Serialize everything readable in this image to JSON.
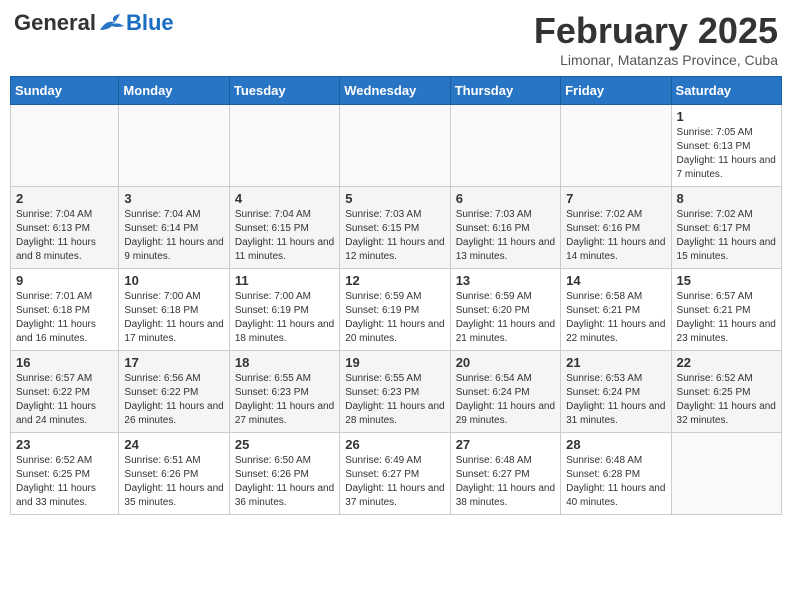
{
  "header": {
    "logo": {
      "general": "General",
      "blue": "Blue"
    },
    "month": "February 2025",
    "location": "Limonar, Matanzas Province, Cuba"
  },
  "days_of_week": [
    "Sunday",
    "Monday",
    "Tuesday",
    "Wednesday",
    "Thursday",
    "Friday",
    "Saturday"
  ],
  "weeks": [
    {
      "days": [
        {
          "num": "",
          "info": ""
        },
        {
          "num": "",
          "info": ""
        },
        {
          "num": "",
          "info": ""
        },
        {
          "num": "",
          "info": ""
        },
        {
          "num": "",
          "info": ""
        },
        {
          "num": "",
          "info": ""
        },
        {
          "num": "1",
          "info": "Sunrise: 7:05 AM\nSunset: 6:13 PM\nDaylight: 11 hours and 7 minutes."
        }
      ]
    },
    {
      "days": [
        {
          "num": "2",
          "info": "Sunrise: 7:04 AM\nSunset: 6:13 PM\nDaylight: 11 hours and 8 minutes."
        },
        {
          "num": "3",
          "info": "Sunrise: 7:04 AM\nSunset: 6:14 PM\nDaylight: 11 hours and 9 minutes."
        },
        {
          "num": "4",
          "info": "Sunrise: 7:04 AM\nSunset: 6:15 PM\nDaylight: 11 hours and 11 minutes."
        },
        {
          "num": "5",
          "info": "Sunrise: 7:03 AM\nSunset: 6:15 PM\nDaylight: 11 hours and 12 minutes."
        },
        {
          "num": "6",
          "info": "Sunrise: 7:03 AM\nSunset: 6:16 PM\nDaylight: 11 hours and 13 minutes."
        },
        {
          "num": "7",
          "info": "Sunrise: 7:02 AM\nSunset: 6:16 PM\nDaylight: 11 hours and 14 minutes."
        },
        {
          "num": "8",
          "info": "Sunrise: 7:02 AM\nSunset: 6:17 PM\nDaylight: 11 hours and 15 minutes."
        }
      ]
    },
    {
      "days": [
        {
          "num": "9",
          "info": "Sunrise: 7:01 AM\nSunset: 6:18 PM\nDaylight: 11 hours and 16 minutes."
        },
        {
          "num": "10",
          "info": "Sunrise: 7:00 AM\nSunset: 6:18 PM\nDaylight: 11 hours and 17 minutes."
        },
        {
          "num": "11",
          "info": "Sunrise: 7:00 AM\nSunset: 6:19 PM\nDaylight: 11 hours and 18 minutes."
        },
        {
          "num": "12",
          "info": "Sunrise: 6:59 AM\nSunset: 6:19 PM\nDaylight: 11 hours and 20 minutes."
        },
        {
          "num": "13",
          "info": "Sunrise: 6:59 AM\nSunset: 6:20 PM\nDaylight: 11 hours and 21 minutes."
        },
        {
          "num": "14",
          "info": "Sunrise: 6:58 AM\nSunset: 6:21 PM\nDaylight: 11 hours and 22 minutes."
        },
        {
          "num": "15",
          "info": "Sunrise: 6:57 AM\nSunset: 6:21 PM\nDaylight: 11 hours and 23 minutes."
        }
      ]
    },
    {
      "days": [
        {
          "num": "16",
          "info": "Sunrise: 6:57 AM\nSunset: 6:22 PM\nDaylight: 11 hours and 24 minutes."
        },
        {
          "num": "17",
          "info": "Sunrise: 6:56 AM\nSunset: 6:22 PM\nDaylight: 11 hours and 26 minutes."
        },
        {
          "num": "18",
          "info": "Sunrise: 6:55 AM\nSunset: 6:23 PM\nDaylight: 11 hours and 27 minutes."
        },
        {
          "num": "19",
          "info": "Sunrise: 6:55 AM\nSunset: 6:23 PM\nDaylight: 11 hours and 28 minutes."
        },
        {
          "num": "20",
          "info": "Sunrise: 6:54 AM\nSunset: 6:24 PM\nDaylight: 11 hours and 29 minutes."
        },
        {
          "num": "21",
          "info": "Sunrise: 6:53 AM\nSunset: 6:24 PM\nDaylight: 11 hours and 31 minutes."
        },
        {
          "num": "22",
          "info": "Sunrise: 6:52 AM\nSunset: 6:25 PM\nDaylight: 11 hours and 32 minutes."
        }
      ]
    },
    {
      "days": [
        {
          "num": "23",
          "info": "Sunrise: 6:52 AM\nSunset: 6:25 PM\nDaylight: 11 hours and 33 minutes."
        },
        {
          "num": "24",
          "info": "Sunrise: 6:51 AM\nSunset: 6:26 PM\nDaylight: 11 hours and 35 minutes."
        },
        {
          "num": "25",
          "info": "Sunrise: 6:50 AM\nSunset: 6:26 PM\nDaylight: 11 hours and 36 minutes."
        },
        {
          "num": "26",
          "info": "Sunrise: 6:49 AM\nSunset: 6:27 PM\nDaylight: 11 hours and 37 minutes."
        },
        {
          "num": "27",
          "info": "Sunrise: 6:48 AM\nSunset: 6:27 PM\nDaylight: 11 hours and 38 minutes."
        },
        {
          "num": "28",
          "info": "Sunrise: 6:48 AM\nSunset: 6:28 PM\nDaylight: 11 hours and 40 minutes."
        },
        {
          "num": "",
          "info": ""
        }
      ]
    }
  ]
}
